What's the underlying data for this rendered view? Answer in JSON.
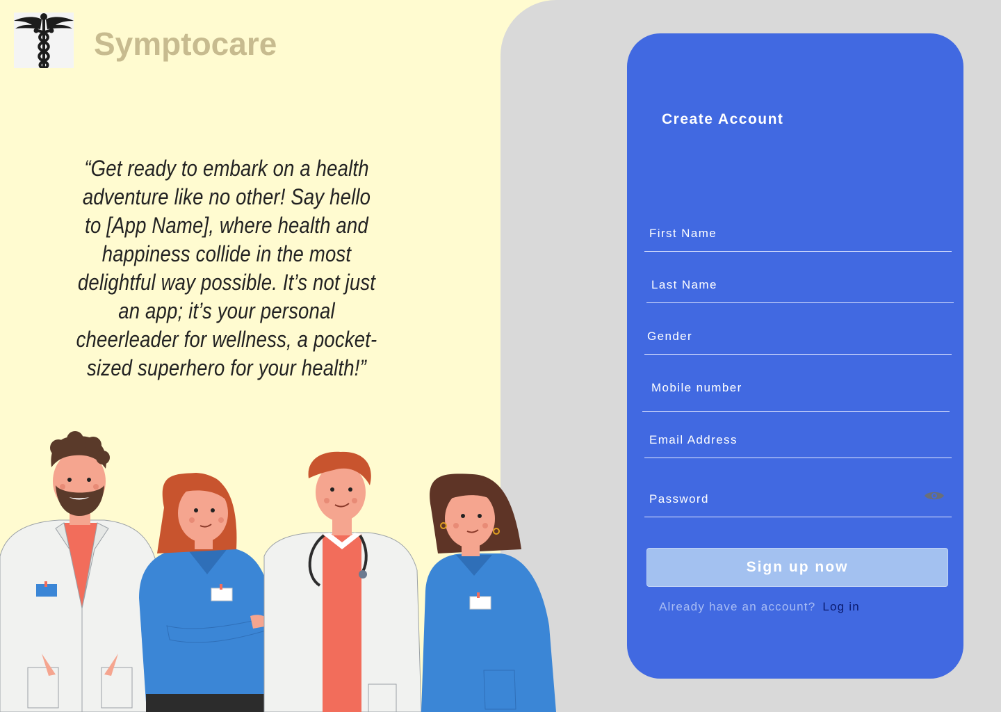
{
  "brand": {
    "name": "Symptocare",
    "logo_icon": "caduceus-icon"
  },
  "quote": "“Get ready to embark on a health adventure like no other! Say hello to [App Name], where health and happiness collide in the most delightful way possible. It’s not just an app; it’s your personal cheerleader for wellness, a pocket-sized superhero for your health!”",
  "form": {
    "title": "Create Account",
    "fields": [
      {
        "label": "First Name"
      },
      {
        "label": "Last Name"
      },
      {
        "label": "Gender"
      },
      {
        "label": "Mobile number"
      },
      {
        "label": "Email Address"
      },
      {
        "label": "Password",
        "icon": "eye-icon"
      }
    ],
    "submit_label": "Sign up now",
    "footer_text": "Already have an account?",
    "login_label": "Log in"
  },
  "colors": {
    "left_bg": "#fffbd0",
    "right_bg": "#d9d9d9",
    "card": "#4169e1",
    "button": "#a3c1f0",
    "brand_text": "#c7bb8f"
  }
}
